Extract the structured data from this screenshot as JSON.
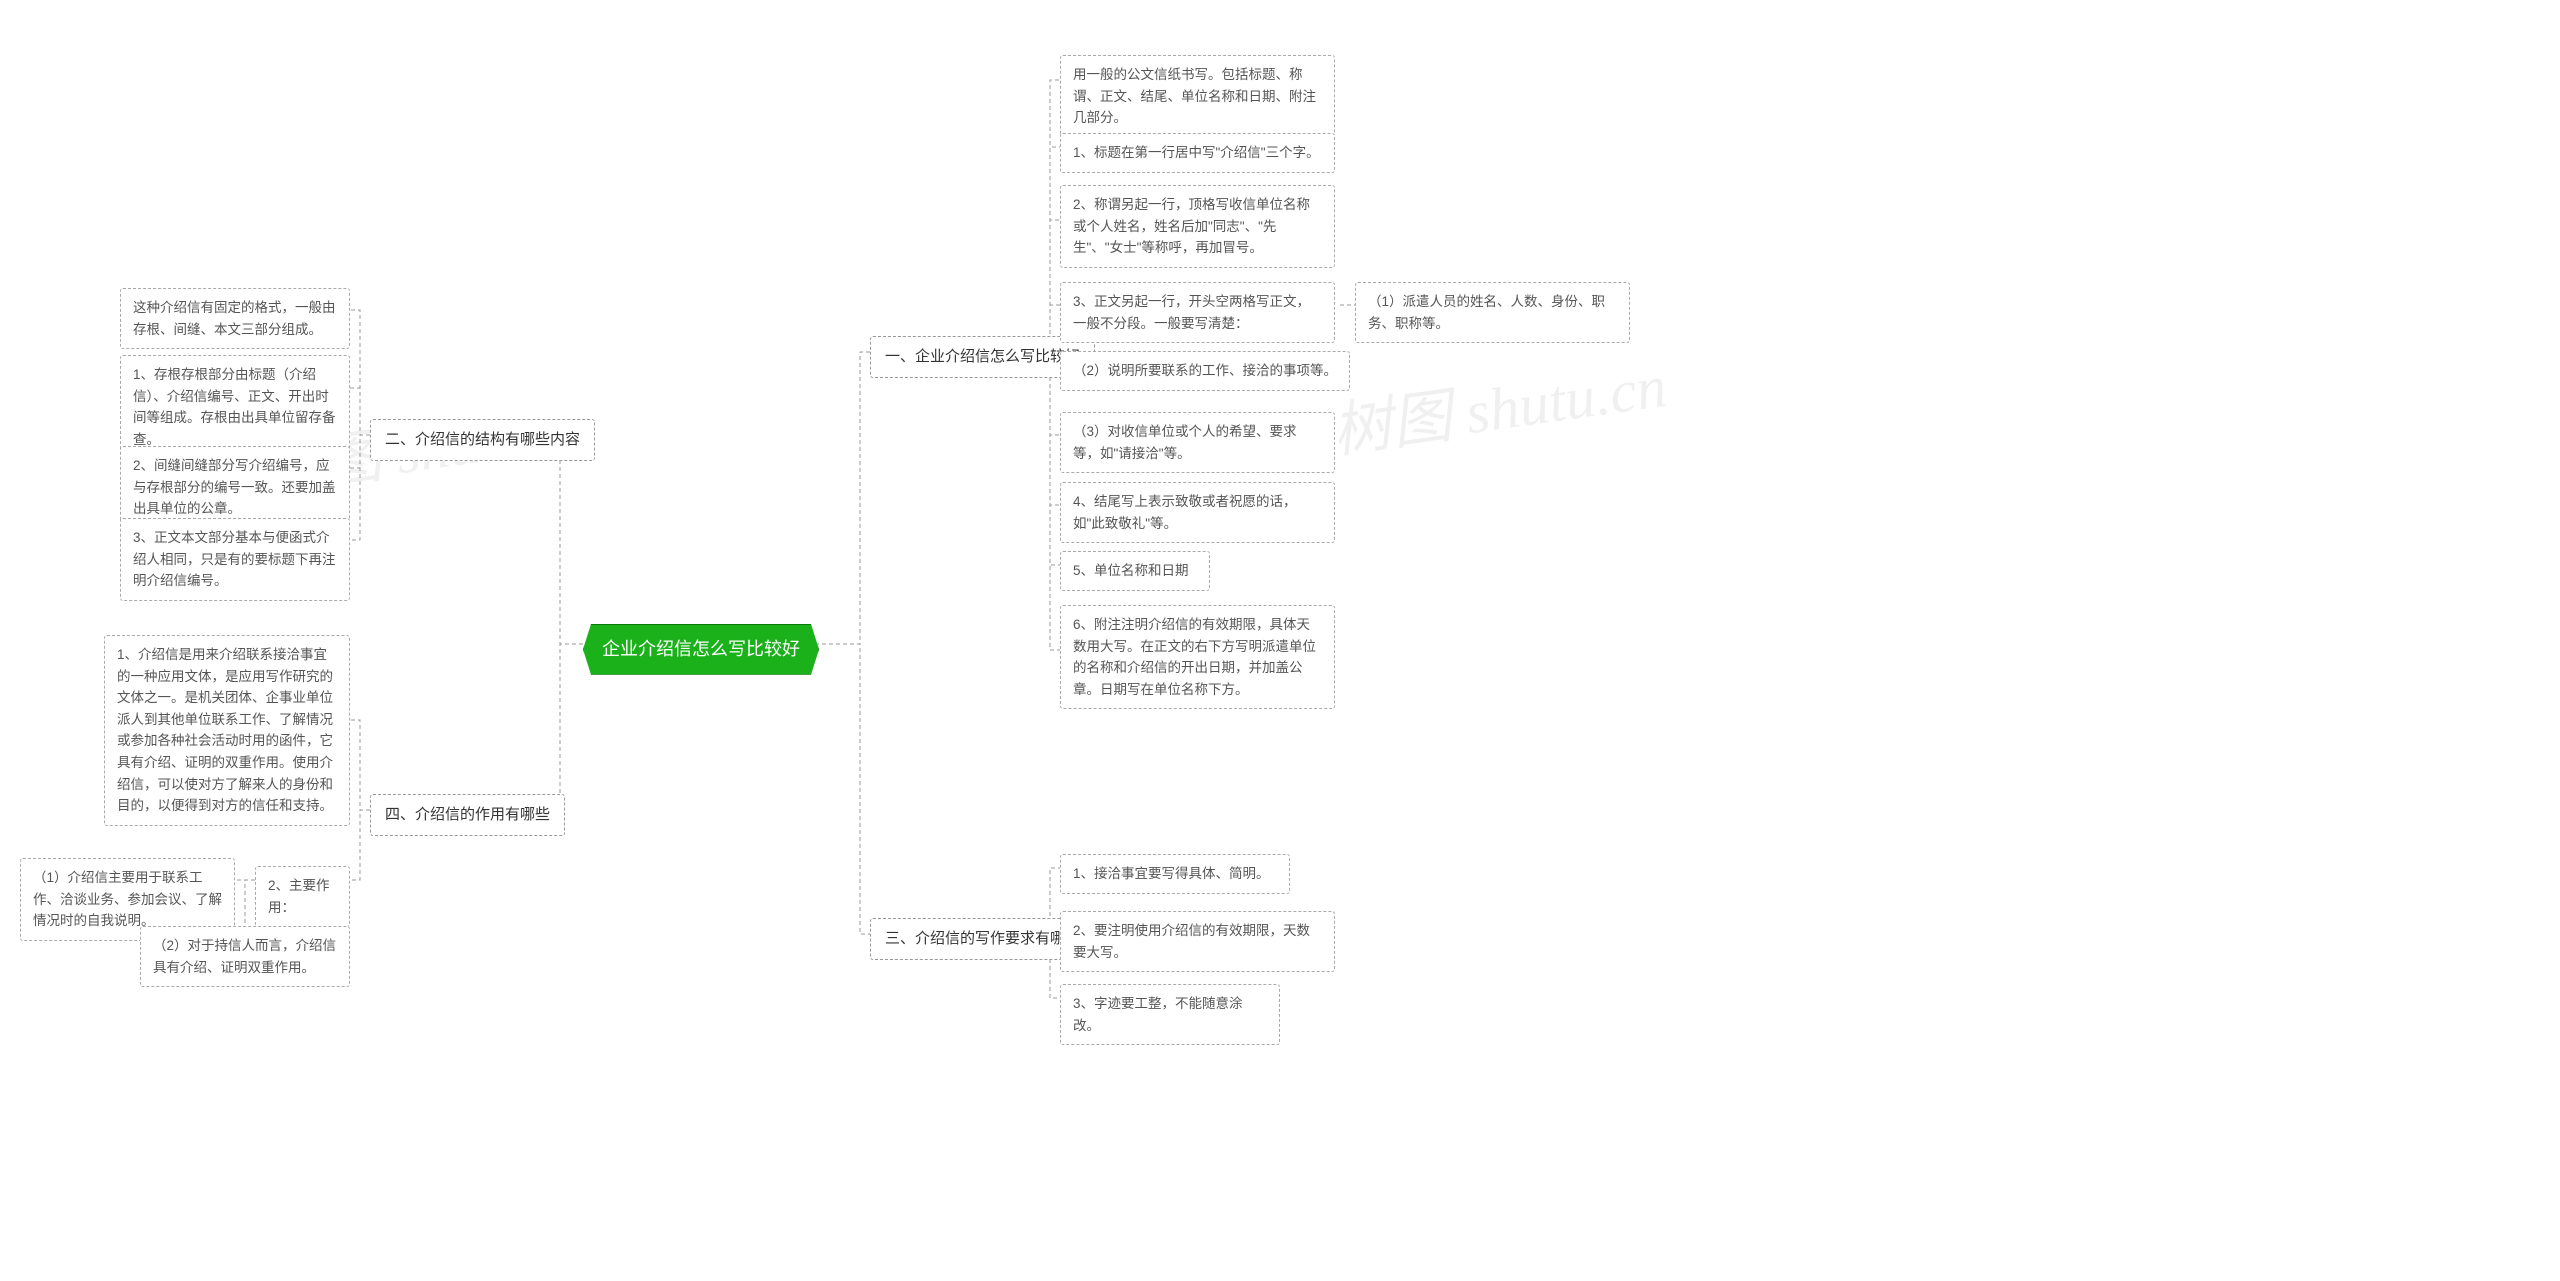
{
  "root": {
    "title": "企业介绍信怎么写比较好"
  },
  "branches": {
    "b1": {
      "title": "一、企业介绍信怎么写比较好"
    },
    "b2": {
      "title": "二、介绍信的结构有哪些内容"
    },
    "b3": {
      "title": "三、介绍信的写作要求有哪些"
    },
    "b4": {
      "title": "四、介绍信的作用有哪些"
    }
  },
  "b1_leaves": {
    "l0": "用一般的公文信纸书写。包括标题、称谓、正文、结尾、单位名称和日期、附注几部分。",
    "l1": "1、标题在第一行居中写\"介绍信\"三个字。",
    "l2": "2、称谓另起一行，顶格写收信单位名称或个人姓名，姓名后加\"同志\"、\"先生\"、\"女士\"等称呼，再加冒号。",
    "l3": "3、正文另起一行，开头空两格写正文，一般不分段。一般要写清楚：",
    "l3a": "（1）派遣人员的姓名、人数、身份、职务、职称等。",
    "l4": "（2）说明所要联系的工作、接洽的事项等。",
    "l5": "（3）对收信单位或个人的希望、要求等，如\"请接洽\"等。",
    "l6": "4、结尾写上表示致敬或者祝愿的话，如\"此致敬礼\"等。",
    "l7": "5、单位名称和日期",
    "l8": "6、附注注明介绍信的有效期限，具体天数用大写。在正文的右下方写明派遣单位的名称和介绍信的开出日期，并加盖公章。日期写在单位名称下方。"
  },
  "b2_leaves": {
    "l0": "这种介绍信有固定的格式，一般由存根、间缝、本文三部分组成。",
    "l1": "1、存根存根部分由标题（介绍信）、介绍信编号、正文、开出时间等组成。存根由出具单位留存备查。",
    "l2": "2、间缝间缝部分写介绍编号，应与存根部分的编号一致。还要加盖出具单位的公章。",
    "l3": "3、正文本文部分基本与便函式介绍人相同，只是有的要标题下再注明介绍信编号。"
  },
  "b3_leaves": {
    "l0": "1、接洽事宜要写得具体、简明。",
    "l1": "2、要注明使用介绍信的有效期限，天数要大写。",
    "l2": "3、字迹要工整，不能随意涂改。"
  },
  "b4_leaves": {
    "l0": "1、介绍信是用来介绍联系接洽事宜的一种应用文体，是应用写作研究的文体之一。是机关团体、企事业单位派人到其他单位联系工作、了解情况或参加各种社会活动时用的函件，它具有介绍、证明的双重作用。使用介绍信，可以使对方了解来人的身份和目的，以便得到对方的信任和支持。",
    "l1": "2、主要作用：",
    "l1a": "（1）介绍信主要用于联系工作、洽谈业务、参加会议、了解情况时的自我说明。",
    "l1b": "（2）对于持信人而言，介绍信具有介绍、证明双重作用。"
  },
  "watermarks": {
    "w1": "树图 shutu.cn",
    "w2": "树图 shutu.cn"
  }
}
